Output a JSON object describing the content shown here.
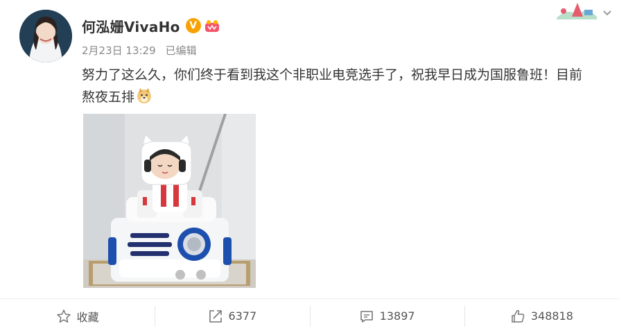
{
  "post": {
    "author": "何泓姗VivaHo",
    "verified_mark": "V",
    "timestamp": "2月23日 13:29",
    "edited": "已编辑",
    "text": "努力了这么久，你们终于看到我这个非职业电竞选手了，祝我早日成为国服鲁班！目前熬夜五排",
    "emoji_icon": "doge-emoji-icon"
  },
  "actions": {
    "favorite": "收藏",
    "repost": "6377",
    "comment": "13897",
    "like": "348818"
  },
  "colors": {
    "verified": "#f7a200",
    "text": "#333333",
    "meta": "#888888"
  }
}
